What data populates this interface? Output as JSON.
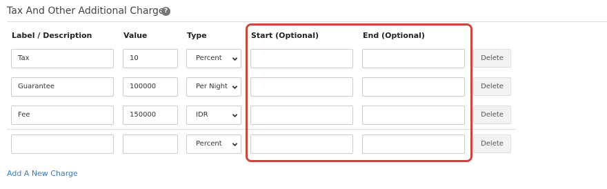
{
  "section": {
    "title": "Tax And Other Additional Charges",
    "help_icon": "question-circle-icon"
  },
  "columns": {
    "label": "Label / Description",
    "value": "Value",
    "type": "Type",
    "start": "Start (Optional)",
    "end": "End (Optional)"
  },
  "rows": [
    {
      "label": "Tax",
      "value": "10",
      "type": "Percent",
      "start": "",
      "end": "",
      "delete_label": "Delete"
    },
    {
      "label": "Guarantee",
      "value": "100000",
      "type": "Per Night",
      "start": "",
      "end": "",
      "delete_label": "Delete"
    },
    {
      "label": "Fee",
      "value": "150000",
      "type": "IDR",
      "start": "",
      "end": "",
      "delete_label": "Delete"
    },
    {
      "label": "",
      "value": "",
      "type": "Percent",
      "start": "",
      "end": "",
      "delete_label": "Delete"
    }
  ],
  "add_link": "Add A New Charge",
  "colors": {
    "highlight": "#c9473d",
    "link": "#3c7ab5"
  }
}
